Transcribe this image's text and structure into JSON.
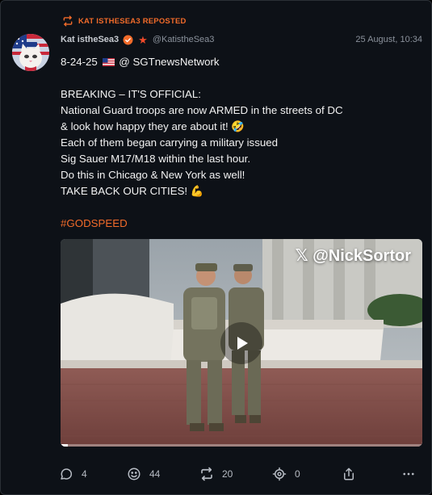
{
  "repost_banner": {
    "text": "KAT ISTHESEA3 REPOSTED",
    "icon": "repost-icon"
  },
  "author": {
    "name": "Kat istheSea3",
    "handle": "@KatistheSea3",
    "verified_icon": "verified-badge-icon",
    "star_icon": "star-icon"
  },
  "post": {
    "date": "25 August, 10:34",
    "line_date": "8-24-25",
    "mention": "@ SGTnewsNetwork",
    "lines": [
      "BREAKING – IT'S OFFICIAL:",
      "National Guard troops are now ARMED in the streets of DC",
      "& look how happy they are about it! 🤣",
      "Each of them began carrying a military issued",
      "Sig Sauer M17/M18 within the last hour.",
      "Do this in Chicago & New York as well!",
      "TAKE BACK OUR CITIES! 💪"
    ],
    "hashtag": "#GODSPEED"
  },
  "media": {
    "watermark": "𝕏 @NickSortor",
    "progress": 0.02
  },
  "actions": {
    "comments": "4",
    "likes": "44",
    "reposts": "20",
    "views": "0"
  },
  "colors": {
    "accent": "#f26b2a",
    "background": "#0d1117"
  }
}
